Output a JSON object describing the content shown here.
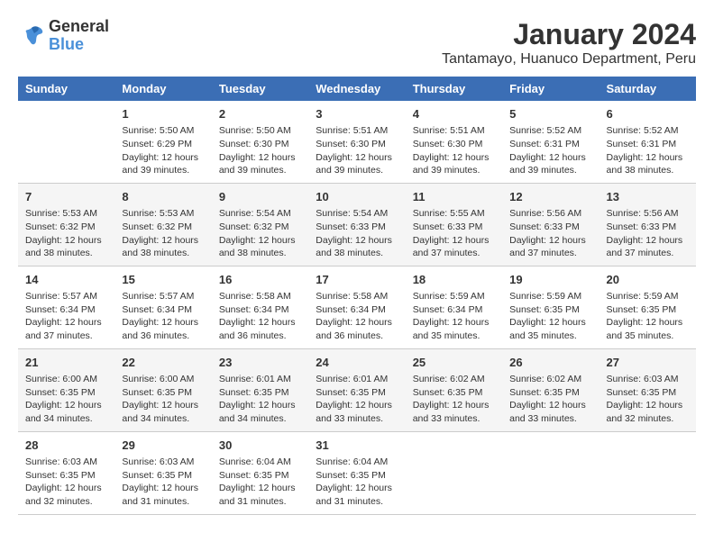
{
  "logo": {
    "line1": "General",
    "line2": "Blue"
  },
  "title": "January 2024",
  "subtitle": "Tantamayo, Huanuco Department, Peru",
  "header_row": [
    "Sunday",
    "Monday",
    "Tuesday",
    "Wednesday",
    "Thursday",
    "Friday",
    "Saturday"
  ],
  "weeks": [
    [
      {
        "day": "",
        "info": ""
      },
      {
        "day": "1",
        "info": "Sunrise: 5:50 AM\nSunset: 6:29 PM\nDaylight: 12 hours\nand 39 minutes."
      },
      {
        "day": "2",
        "info": "Sunrise: 5:50 AM\nSunset: 6:30 PM\nDaylight: 12 hours\nand 39 minutes."
      },
      {
        "day": "3",
        "info": "Sunrise: 5:51 AM\nSunset: 6:30 PM\nDaylight: 12 hours\nand 39 minutes."
      },
      {
        "day": "4",
        "info": "Sunrise: 5:51 AM\nSunset: 6:30 PM\nDaylight: 12 hours\nand 39 minutes."
      },
      {
        "day": "5",
        "info": "Sunrise: 5:52 AM\nSunset: 6:31 PM\nDaylight: 12 hours\nand 39 minutes."
      },
      {
        "day": "6",
        "info": "Sunrise: 5:52 AM\nSunset: 6:31 PM\nDaylight: 12 hours\nand 38 minutes."
      }
    ],
    [
      {
        "day": "7",
        "info": "Sunrise: 5:53 AM\nSunset: 6:32 PM\nDaylight: 12 hours\nand 38 minutes."
      },
      {
        "day": "8",
        "info": "Sunrise: 5:53 AM\nSunset: 6:32 PM\nDaylight: 12 hours\nand 38 minutes."
      },
      {
        "day": "9",
        "info": "Sunrise: 5:54 AM\nSunset: 6:32 PM\nDaylight: 12 hours\nand 38 minutes."
      },
      {
        "day": "10",
        "info": "Sunrise: 5:54 AM\nSunset: 6:33 PM\nDaylight: 12 hours\nand 38 minutes."
      },
      {
        "day": "11",
        "info": "Sunrise: 5:55 AM\nSunset: 6:33 PM\nDaylight: 12 hours\nand 37 minutes."
      },
      {
        "day": "12",
        "info": "Sunrise: 5:56 AM\nSunset: 6:33 PM\nDaylight: 12 hours\nand 37 minutes."
      },
      {
        "day": "13",
        "info": "Sunrise: 5:56 AM\nSunset: 6:33 PM\nDaylight: 12 hours\nand 37 minutes."
      }
    ],
    [
      {
        "day": "14",
        "info": "Sunrise: 5:57 AM\nSunset: 6:34 PM\nDaylight: 12 hours\nand 37 minutes."
      },
      {
        "day": "15",
        "info": "Sunrise: 5:57 AM\nSunset: 6:34 PM\nDaylight: 12 hours\nand 36 minutes."
      },
      {
        "day": "16",
        "info": "Sunrise: 5:58 AM\nSunset: 6:34 PM\nDaylight: 12 hours\nand 36 minutes."
      },
      {
        "day": "17",
        "info": "Sunrise: 5:58 AM\nSunset: 6:34 PM\nDaylight: 12 hours\nand 36 minutes."
      },
      {
        "day": "18",
        "info": "Sunrise: 5:59 AM\nSunset: 6:34 PM\nDaylight: 12 hours\nand 35 minutes."
      },
      {
        "day": "19",
        "info": "Sunrise: 5:59 AM\nSunset: 6:35 PM\nDaylight: 12 hours\nand 35 minutes."
      },
      {
        "day": "20",
        "info": "Sunrise: 5:59 AM\nSunset: 6:35 PM\nDaylight: 12 hours\nand 35 minutes."
      }
    ],
    [
      {
        "day": "21",
        "info": "Sunrise: 6:00 AM\nSunset: 6:35 PM\nDaylight: 12 hours\nand 34 minutes."
      },
      {
        "day": "22",
        "info": "Sunrise: 6:00 AM\nSunset: 6:35 PM\nDaylight: 12 hours\nand 34 minutes."
      },
      {
        "day": "23",
        "info": "Sunrise: 6:01 AM\nSunset: 6:35 PM\nDaylight: 12 hours\nand 34 minutes."
      },
      {
        "day": "24",
        "info": "Sunrise: 6:01 AM\nSunset: 6:35 PM\nDaylight: 12 hours\nand 33 minutes."
      },
      {
        "day": "25",
        "info": "Sunrise: 6:02 AM\nSunset: 6:35 PM\nDaylight: 12 hours\nand 33 minutes."
      },
      {
        "day": "26",
        "info": "Sunrise: 6:02 AM\nSunset: 6:35 PM\nDaylight: 12 hours\nand 33 minutes."
      },
      {
        "day": "27",
        "info": "Sunrise: 6:03 AM\nSunset: 6:35 PM\nDaylight: 12 hours\nand 32 minutes."
      }
    ],
    [
      {
        "day": "28",
        "info": "Sunrise: 6:03 AM\nSunset: 6:35 PM\nDaylight: 12 hours\nand 32 minutes."
      },
      {
        "day": "29",
        "info": "Sunrise: 6:03 AM\nSunset: 6:35 PM\nDaylight: 12 hours\nand 31 minutes."
      },
      {
        "day": "30",
        "info": "Sunrise: 6:04 AM\nSunset: 6:35 PM\nDaylight: 12 hours\nand 31 minutes."
      },
      {
        "day": "31",
        "info": "Sunrise: 6:04 AM\nSunset: 6:35 PM\nDaylight: 12 hours\nand 31 minutes."
      },
      {
        "day": "",
        "info": ""
      },
      {
        "day": "",
        "info": ""
      },
      {
        "day": "",
        "info": ""
      }
    ]
  ]
}
